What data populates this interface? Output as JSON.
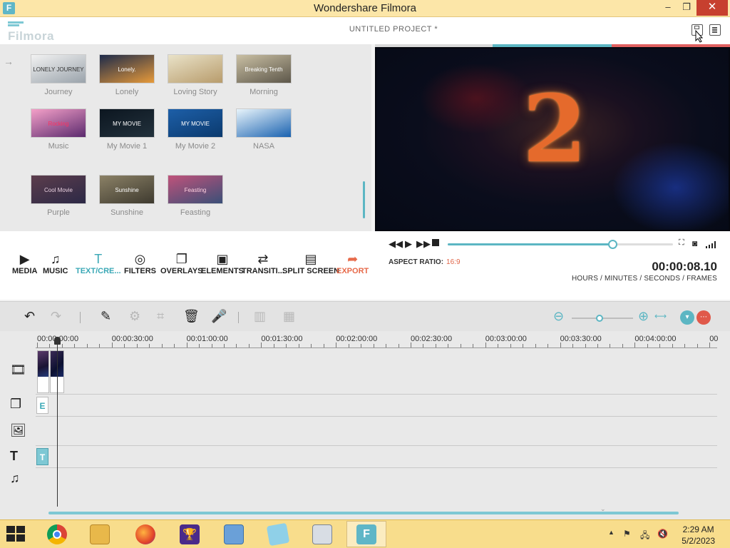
{
  "window": {
    "app_icon_letter": "F",
    "title": "Wondershare Filmora",
    "minimize": "–",
    "restore": "❐",
    "close": "✕"
  },
  "header": {
    "logo": "Filmora",
    "project_title": "UNTITLED PROJECT *"
  },
  "library": {
    "back_icon": "→",
    "items": [
      {
        "label": "Journey",
        "thumb_text": "LONELY JOURNEY",
        "colors": [
          "#f2f2f2",
          "#9aa3ab"
        ],
        "text_color": "#333"
      },
      {
        "label": "Lonely",
        "thumb_text": "Lonely.",
        "colors": [
          "#1c2a4a",
          "#e79a3a"
        ],
        "text_color": "#fff"
      },
      {
        "label": "Loving Story",
        "thumb_text": "",
        "colors": [
          "#e9e2c8",
          "#b89c6c"
        ],
        "text_color": "#fff"
      },
      {
        "label": "Morning",
        "thumb_text": "Breaking Tenth",
        "colors": [
          "#c9bfa3",
          "#5d574a"
        ],
        "text_color": "#fff"
      },
      {
        "label": "Music",
        "thumb_text": "Rocking",
        "colors": [
          "#f4a0c8",
          "#5b2a6e"
        ],
        "text_color": "#ff3060"
      },
      {
        "label": "My Movie 1",
        "thumb_text": "MY MOVIE",
        "colors": [
          "#0c1620",
          "#22313c"
        ],
        "text_color": "#fff"
      },
      {
        "label": "My Movie 2",
        "thumb_text": "MY MOVIE",
        "colors": [
          "#1d5fa8",
          "#0b3a6e"
        ],
        "text_color": "#fff"
      },
      {
        "label": "NASA",
        "thumb_text": "",
        "colors": [
          "#e8f4fb",
          "#1a62b0"
        ],
        "text_color": "#fff"
      },
      {
        "label": "Purple",
        "thumb_text": "Cool Movie",
        "colors": [
          "#5c3d4c",
          "#2c2946"
        ],
        "text_color": "#e8d0e0"
      },
      {
        "label": "Sunshine",
        "thumb_text": "Sunshine",
        "colors": [
          "#8b8166",
          "#3e3a2f"
        ],
        "text_color": "#fff"
      },
      {
        "label": "Feasting",
        "thumb_text": "Feasting",
        "colors": [
          "#c0527a",
          "#3a4f78"
        ],
        "text_color": "#ffd0e0"
      }
    ]
  },
  "preview": {
    "countdown": "2"
  },
  "player": {
    "progress": 0.73,
    "aspect_label": "ASPECT RATIO:",
    "aspect_value": "16:9",
    "timecode": "00:00:08.10",
    "timecode_units": "HOURS / MINUTES / SECONDS / FRAMES"
  },
  "tools": [
    {
      "label": "MEDIA",
      "icon": "media-icon",
      "glyph": "▶"
    },
    {
      "label": "MUSIC",
      "icon": "music-icon",
      "glyph": "♫"
    },
    {
      "label": "TEXT/CRE...",
      "icon": "text-icon",
      "glyph": "T"
    },
    {
      "label": "FILTERS",
      "icon": "filters-icon",
      "glyph": "◎"
    },
    {
      "label": "OVERLAYS",
      "icon": "overlays-icon",
      "glyph": "❐"
    },
    {
      "label": "ELEMENTS",
      "icon": "elements-icon",
      "glyph": "▣"
    },
    {
      "label": "TRANSITI...",
      "icon": "transitions-icon",
      "glyph": "⇄"
    },
    {
      "label": "SPLIT SCREEN",
      "icon": "split-screen-icon",
      "glyph": "▤"
    },
    {
      "label": "EXPORT",
      "icon": "export-icon",
      "glyph": "➦"
    }
  ],
  "timeline": {
    "zoom_level": 0.45,
    "ruler": [
      "00:00:00:00",
      "00:00:30:00",
      "00:01:00:00",
      "00:01:30:00",
      "00:02:00:00",
      "00:02:30:00",
      "00:03:00:00",
      "00:03:30:00",
      "00:04:00:00",
      "00"
    ],
    "element_chip": "E",
    "text_chip": "T"
  },
  "taskbar": {
    "time": "2:29 AM",
    "date": "5/2/2023",
    "filmora_letter": "F"
  },
  "colors": {
    "accent": "#5cb6c3",
    "export": "#e76a4a",
    "titlebar": "#fce6a8"
  }
}
